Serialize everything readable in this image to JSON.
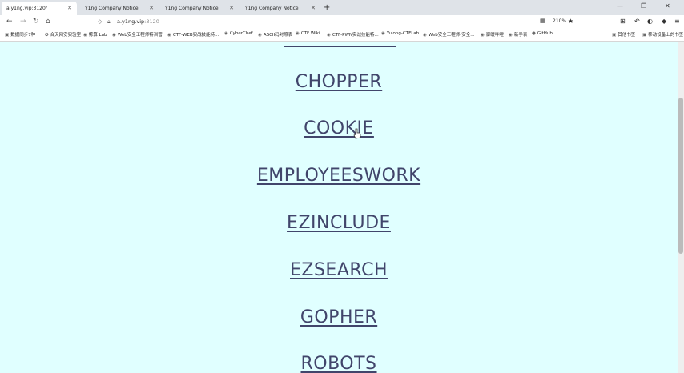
{
  "tabs": [
    {
      "label": "a.y1ng.vip:3120/",
      "active": true
    },
    {
      "label": "Y1ng Company Notice",
      "active": false
    },
    {
      "label": "Y1ng Company Notice",
      "active": false
    },
    {
      "label": "Y1ng Company Notice",
      "active": false
    }
  ],
  "address_bar": {
    "url_host": "a.y1ng.vip",
    "url_rest": ":3120",
    "zoom": "210%"
  },
  "bookmarks": [
    {
      "label": "数据同步7种",
      "icon": "folder-icon"
    },
    {
      "label": "合天网安实验室",
      "icon": "star-icon"
    },
    {
      "label": "鲸算 Lab",
      "icon": "globe-icon"
    },
    {
      "label": "Web安全工程师特训营",
      "icon": "globe-icon"
    },
    {
      "label": "CTF-WEB实战技能特...",
      "icon": "globe-icon"
    },
    {
      "label": "CyberChef",
      "icon": "globe-icon"
    },
    {
      "label": "ASCII码对照表",
      "icon": "globe-icon"
    },
    {
      "label": "CTF Wiki",
      "icon": "globe-icon"
    },
    {
      "label": "CTF-PWN实战技能特...",
      "icon": "globe-icon"
    },
    {
      "label": "Yulong-CTFLab",
      "icon": "globe-icon"
    },
    {
      "label": "Web安全工程师-安全...",
      "icon": "globe-icon"
    },
    {
      "label": "御暖哔哩",
      "icon": "globe-icon"
    },
    {
      "label": "新手表",
      "icon": "globe-icon"
    },
    {
      "label": "GitHub",
      "icon": "github-icon"
    },
    {
      "label": "其他书签",
      "icon": "folder-icon"
    },
    {
      "label": "移动设备上的书签",
      "icon": "folder-icon"
    }
  ],
  "challenges": [
    "CHOPPER",
    "COOKIE",
    "EMPLOYEESWORK",
    "EZINCLUDE",
    "EZSEARCH",
    "GOPHER",
    "ROBOTS"
  ],
  "colors": {
    "page_bg": "#e0ffff",
    "link": "#41456b"
  }
}
